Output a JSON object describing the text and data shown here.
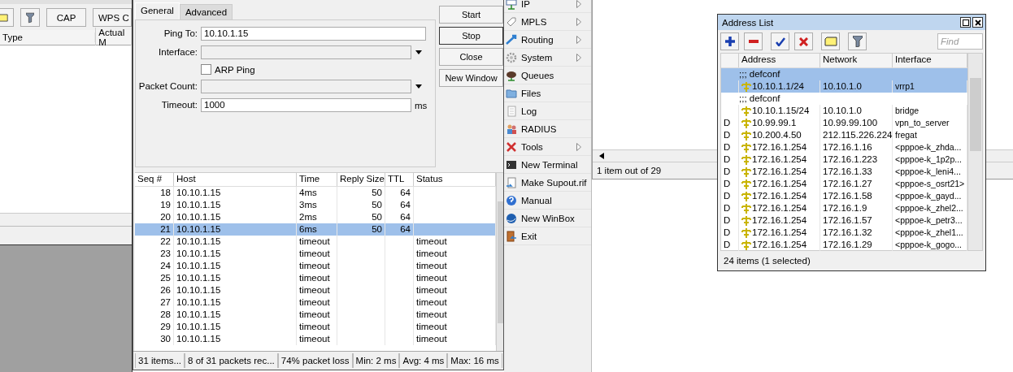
{
  "back_window": {
    "buttons": [
      "CAP",
      "WPS C"
    ],
    "columns": [
      "Type",
      "Actual M"
    ]
  },
  "ping_window": {
    "tabs": [
      {
        "label": "General",
        "selected": true
      },
      {
        "label": "Advanced",
        "selected": false
      }
    ],
    "fields": [
      {
        "kind": "text",
        "label": "Ping To:",
        "value": "10.10.1.15"
      },
      {
        "kind": "dropdown",
        "label": "Interface:"
      },
      {
        "kind": "checkbox",
        "label": "ARP Ping",
        "checked": false
      },
      {
        "kind": "dropdown",
        "label": "Packet Count:"
      },
      {
        "kind": "text",
        "label": "Timeout:",
        "value": "1000",
        "unit": "ms"
      }
    ],
    "buttons": [
      {
        "label": "Start",
        "focused": false
      },
      {
        "label": "Stop",
        "focused": true
      },
      {
        "label": "Close",
        "focused": false
      },
      {
        "label": "New Window",
        "focused": false
      }
    ],
    "table": {
      "columns": [
        "Seq #",
        "Host",
        "Time",
        "Reply Size",
        "TTL",
        "Status"
      ],
      "rows": [
        {
          "seq": "18",
          "host": "10.10.1.15",
          "time": "4ms",
          "reply_size": "50",
          "ttl": "64",
          "selected": false
        },
        {
          "seq": "19",
          "host": "10.10.1.15",
          "time": "3ms",
          "reply_size": "50",
          "ttl": "64",
          "selected": false
        },
        {
          "seq": "20",
          "host": "10.10.1.15",
          "time": "2ms",
          "reply_size": "50",
          "ttl": "64",
          "selected": false
        },
        {
          "seq": "21",
          "host": "10.10.1.15",
          "time": "6ms",
          "reply_size": "50",
          "ttl": "64",
          "selected": true
        },
        {
          "seq": "22",
          "host": "10.10.1.15",
          "time": "timeout",
          "status": "timeout",
          "selected": false
        },
        {
          "seq": "23",
          "host": "10.10.1.15",
          "time": "timeout",
          "status": "timeout",
          "selected": false
        },
        {
          "seq": "24",
          "host": "10.10.1.15",
          "time": "timeout",
          "status": "timeout",
          "selected": false
        },
        {
          "seq": "25",
          "host": "10.10.1.15",
          "time": "timeout",
          "status": "timeout",
          "selected": false
        },
        {
          "seq": "26",
          "host": "10.10.1.15",
          "time": "timeout",
          "status": "timeout",
          "selected": false
        },
        {
          "seq": "27",
          "host": "10.10.1.15",
          "time": "timeout",
          "status": "timeout",
          "selected": false
        },
        {
          "seq": "28",
          "host": "10.10.1.15",
          "time": "timeout",
          "status": "timeout",
          "selected": false
        },
        {
          "seq": "29",
          "host": "10.10.1.15",
          "time": "timeout",
          "status": "timeout",
          "selected": false
        },
        {
          "seq": "30",
          "host": "10.10.1.15",
          "time": "timeout",
          "status": "timeout",
          "selected": false
        }
      ]
    },
    "status_bar": [
      "31 items...",
      "8 of 31 packets rec...",
      "74% packet loss",
      "Min: 2 ms",
      "Avg: 4 ms",
      "Max: 16 ms"
    ]
  },
  "menu": {
    "items": [
      {
        "label": "IP",
        "submenu": true
      },
      {
        "label": "MPLS",
        "submenu": true
      },
      {
        "label": "Routing",
        "submenu": true
      },
      {
        "label": "System",
        "submenu": true
      },
      {
        "label": "Queues",
        "submenu": false
      },
      {
        "label": "Files",
        "submenu": false
      },
      {
        "label": "Log",
        "submenu": false
      },
      {
        "label": "RADIUS",
        "submenu": false
      },
      {
        "label": "Tools",
        "submenu": true
      },
      {
        "label": "New Terminal",
        "submenu": false
      },
      {
        "label": "Make Supout.rif",
        "submenu": false
      },
      {
        "label": "Manual",
        "submenu": false
      },
      {
        "label": "New WinBox",
        "submenu": false
      },
      {
        "label": "Exit",
        "submenu": false
      }
    ]
  },
  "right_window": {
    "status": "1 item out of 29"
  },
  "address_list": {
    "title": "Address List",
    "find_placeholder": "Find",
    "columns": [
      "Address",
      "Network",
      "Interface"
    ],
    "rows": [
      {
        "kind": "comment",
        "text": ";;; defconf",
        "selected": true
      },
      {
        "kind": "entry",
        "address": "10.10.1.1/24",
        "network": "10.10.1.0",
        "interface": "vrrp1",
        "selected": true
      },
      {
        "kind": "comment",
        "text": ";;; defconf",
        "selected": false
      },
      {
        "kind": "entry",
        "address": "10.10.1.15/24",
        "network": "10.10.1.0",
        "interface": "bridge",
        "selected": false
      },
      {
        "kind": "entry",
        "flag": "D",
        "address": "10.99.99.1",
        "network": "10.99.99.100",
        "interface": "vpn_to_server",
        "selected": false
      },
      {
        "kind": "entry",
        "flag": "D",
        "address": "10.200.4.50",
        "network": "212.115.226.224",
        "interface": "fregat",
        "selected": false
      },
      {
        "kind": "entry",
        "flag": "D",
        "address": "172.16.1.254",
        "network": "172.16.1.16",
        "interface": "<pppoe-k_zhda...",
        "selected": false
      },
      {
        "kind": "entry",
        "flag": "D",
        "address": "172.16.1.254",
        "network": "172.16.1.223",
        "interface": "<pppoe-k_1p2p...",
        "selected": false
      },
      {
        "kind": "entry",
        "flag": "D",
        "address": "172.16.1.254",
        "network": "172.16.1.33",
        "interface": "<pppoe-k_leni4...",
        "selected": false
      },
      {
        "kind": "entry",
        "flag": "D",
        "address": "172.16.1.254",
        "network": "172.16.1.27",
        "interface": "<pppoe-s_osrt21>",
        "selected": false
      },
      {
        "kind": "entry",
        "flag": "D",
        "address": "172.16.1.254",
        "network": "172.16.1.58",
        "interface": "<pppoe-k_gayd...",
        "selected": false
      },
      {
        "kind": "entry",
        "flag": "D",
        "address": "172.16.1.254",
        "network": "172.16.1.9",
        "interface": "<pppoe-k_zhel2...",
        "selected": false
      },
      {
        "kind": "entry",
        "flag": "D",
        "address": "172.16.1.254",
        "network": "172.16.1.57",
        "interface": "<pppoe-k_petr3...",
        "selected": false
      },
      {
        "kind": "entry",
        "flag": "D",
        "address": "172.16.1.254",
        "network": "172.16.1.32",
        "interface": "<pppoe-k_zhel1...",
        "selected": false
      },
      {
        "kind": "entry",
        "flag": "D",
        "address": "172.16.1.254",
        "network": "172.16.1.29",
        "interface": "<pppoe-k_gogo...",
        "selected": false
      }
    ],
    "status": "24 items (1 selected)"
  }
}
